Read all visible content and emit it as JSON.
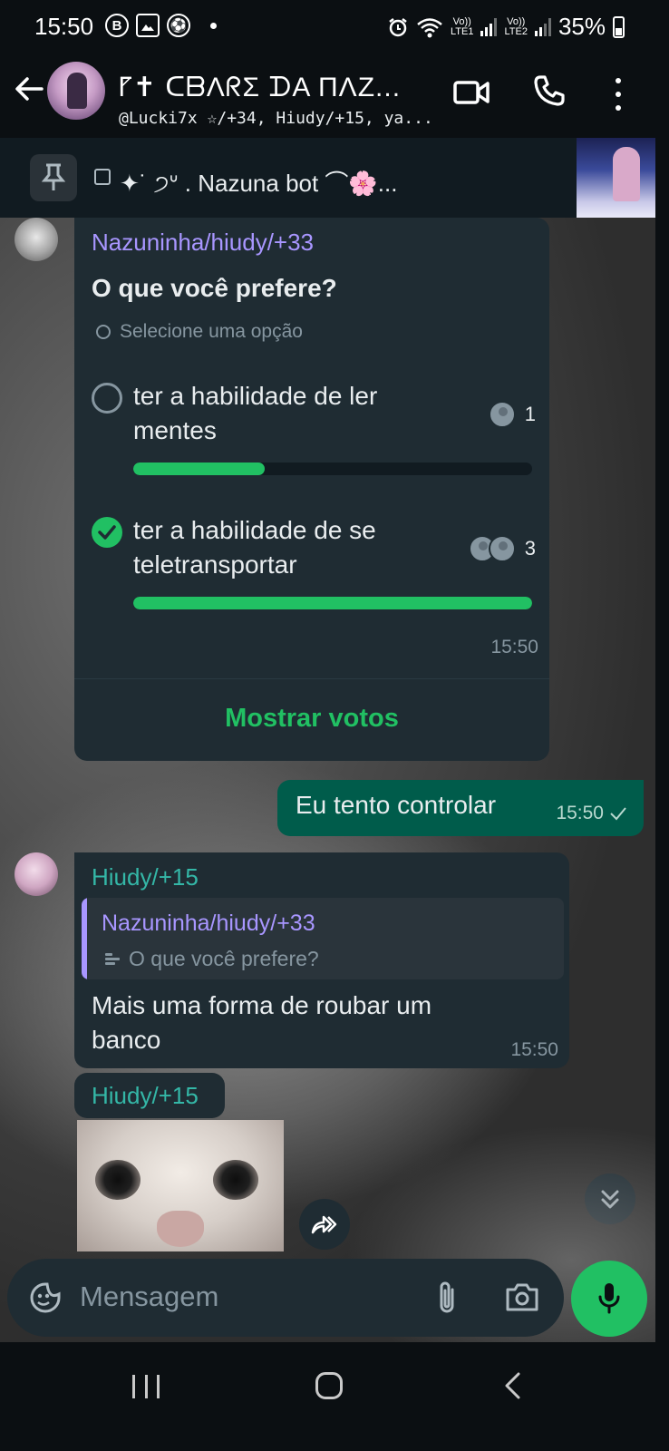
{
  "status_bar": {
    "time": "15:50",
    "net1_top": "Vo))",
    "net1_bottom": "LTE1",
    "net2_top": "Vo))",
    "net2_bottom": "LTE2",
    "battery": "35%"
  },
  "header": {
    "title": "⹍✝ ᑕᗷΛᖇΣ ᗪA ΠΛZ...",
    "subtitle": "@Lucki7x ☆/+34, Hiudy/+15, ya..."
  },
  "pinned": {
    "text": "✦˙ ੭ᐡ .  Nazuna bot ⌒🌸..."
  },
  "poll_message": {
    "sender": "Nazuninha/hiudy/+33",
    "question": "O que você prefere?",
    "hint": "Selecione uma opção",
    "options": [
      {
        "label": "ter a habilidade de ler mentes",
        "votes": "1",
        "fraction": 0.33,
        "selected": false
      },
      {
        "label": "ter a habilidade de se teletransportar",
        "votes": "3",
        "fraction": 1.0,
        "selected": true
      }
    ],
    "time": "15:50",
    "show_votes": "Mostrar votos"
  },
  "outgoing_message": {
    "text": "Eu tento controlar",
    "time": "15:50"
  },
  "reply_message": {
    "sender": "Hiudy/+15",
    "quoted_sender": "Nazuninha/hiudy/+33",
    "quoted_text": "O que você prefere?",
    "text": "Mais uma forma de roubar um banco",
    "time": "15:50"
  },
  "image_message": {
    "sender": "Hiudy/+15"
  },
  "composer": {
    "placeholder": "Mensagem"
  },
  "colors": {
    "accent_green": "#21c063",
    "outgoing_bubble": "#005c4b",
    "incoming_bubble": "#1f2c33",
    "poll_sender": "#a896ff",
    "reply_sender": "#34b7a7"
  }
}
